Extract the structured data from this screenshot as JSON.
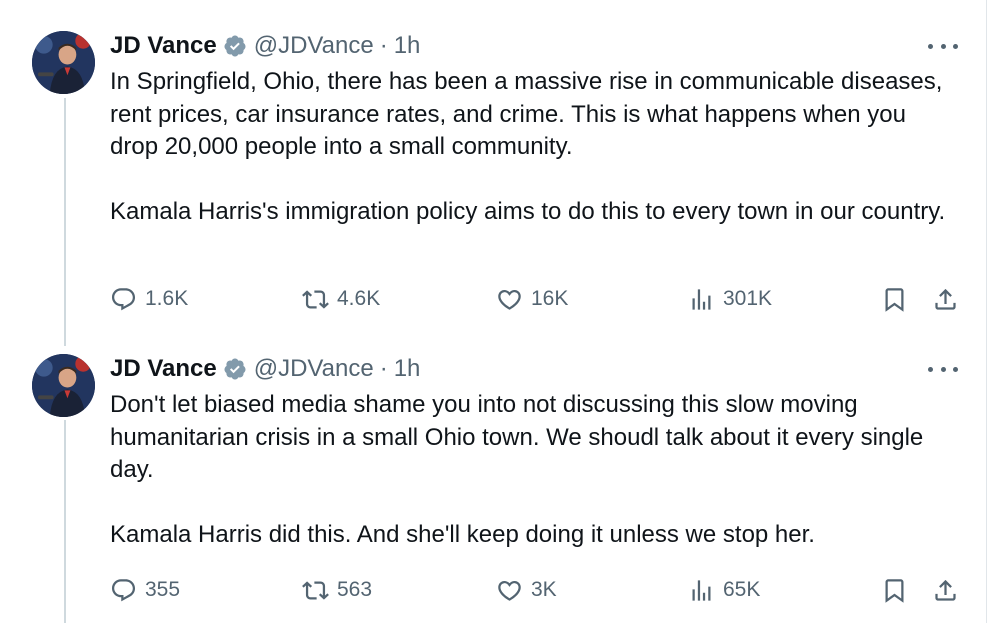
{
  "tweets": [
    {
      "author": {
        "name": "JD Vance",
        "handle": "@JDVance",
        "time": "1h"
      },
      "text": "In Springfield, Ohio, there has been a massive rise in communicable diseases, rent prices, car insurance rates, and crime. This is what happens when you drop 20,000 people into a small community.\n\nKamala Harris's immigration policy aims to do this to every town in our country.",
      "stats": {
        "replies": "1.6K",
        "reposts": "4.6K",
        "likes": "16K",
        "views": "301K"
      }
    },
    {
      "author": {
        "name": "JD Vance",
        "handle": "@JDVance",
        "time": "1h"
      },
      "text": "Don't let biased media shame you into not discussing this slow moving humanitarian crisis in a small Ohio town. We shoudl talk about it every single day.\n\nKamala Harris did this. And she'll keep doing it unless we stop her.",
      "stats": {
        "replies": "355",
        "reposts": "563",
        "likes": "3K",
        "views": "65K"
      }
    }
  ],
  "separator": "·",
  "icons": [
    "verified-badge-icon",
    "more-icon",
    "reply-icon",
    "repost-icon",
    "like-icon",
    "views-icon",
    "bookmark-icon",
    "share-icon"
  ],
  "colors": {
    "text": "#0f1419",
    "muted": "#536471",
    "verified": "#829aab",
    "thread_line": "#cfd9de"
  }
}
